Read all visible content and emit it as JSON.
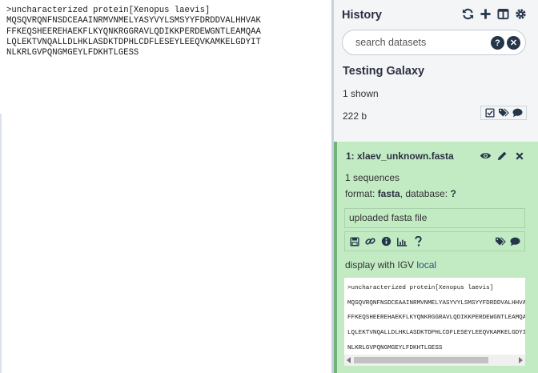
{
  "center_panel": {
    "fasta_lines": [
      ">uncharacterized protein[Xenopus laevis]",
      "MQSQVRQNFNSDCEAAINRMVNMELYASYVYLSMSYYFDRDDVALHHVAK",
      "FFKEQSHEEREHAEKFLKYQNKRGGRAVLQDIKKPERDEWGNTLEAMQAA",
      "LQLEKTVNQALLDLHKLASDKTDPHLCDFLESEYLEEQVKAMKELGDYIT",
      "NLKRLGVPQNGMGEYLFDKHTLGESS"
    ]
  },
  "history": {
    "title": "History",
    "icons": [
      "refresh-icon",
      "plus-icon",
      "columns-icon",
      "gear-icon"
    ],
    "search_placeholder": "search datasets",
    "name": "Testing Galaxy",
    "shown": "1 shown",
    "size": "222 b"
  },
  "dataset": {
    "title": "1: xlaev_unknown.fasta",
    "sequences": "1 sequences",
    "format_label": "format:",
    "format_value": "fasta",
    "database_label": ", database:",
    "database_value": "?",
    "info": "uploaded fasta file",
    "display_label": "display with IGV",
    "display_link": "local",
    "peek_lines": [
      ">uncharacterized protein[Xenopus laevis]",
      "MQSQVRQNFNSDCEAAINRMVNMELYASYVYLSMSYYFDRDDVALHHVAK",
      "FFKEQSHEEREHAEKFLKYQNKRGGRAVLQDIKKPERDEWGNTLEAMQAA",
      "LQLEKTVNQALLDLHKLASDKTDPHLCDFLESEYLEEQVKAMKELGDYIT",
      "NLKRLGVPQNGMGEYLFDKHTLGESS"
    ]
  },
  "colors": {
    "dataset_ok_bg": "#c2ebc4",
    "panel_bg": "#f4f5f7",
    "dark": "#25364a",
    "link": "#25537b"
  }
}
